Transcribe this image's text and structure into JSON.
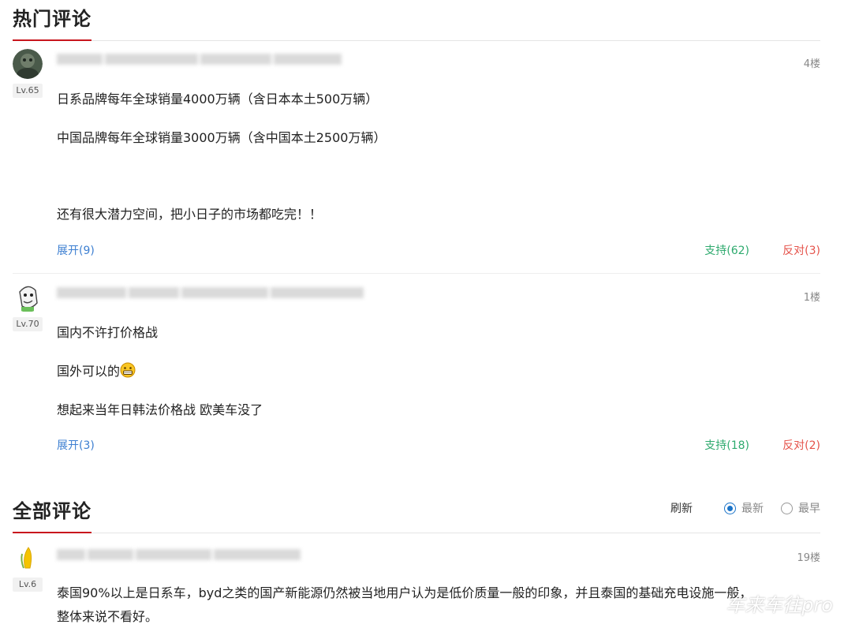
{
  "hot_section": {
    "title": "热门评论"
  },
  "hot_comments": [
    {
      "level": "Lv.65",
      "floor": "4楼",
      "lines": [
        "日系品牌每年全球销量4000万辆（含日本本土500万辆）",
        "中国品牌每年全球销量3000万辆（含中国本土2500万辆）",
        "还有很大潜力空间，把小日子的市场都吃完！！"
      ],
      "expand": "展开(9)",
      "support": "支持(62)",
      "oppose": "反对(3)"
    },
    {
      "level": "Lv.70",
      "floor": "1楼",
      "lines": [
        "国内不许打价格战",
        "国外可以的",
        " 想起来当年日韩法价格战  欧美车没了"
      ],
      "expand": "展开(3)",
      "support": "支持(18)",
      "oppose": "反对(2)"
    }
  ],
  "all_section": {
    "title": "全部评论",
    "refresh": "刷新",
    "sort_newest": "最新",
    "sort_oldest": "最早"
  },
  "all_comments": [
    {
      "level": "Lv.6",
      "floor": "19楼",
      "lines": [
        "泰国90%以上是日系车，byd之类的国产新能源仍然被当地用户认为是低价质量一般的印象，并且泰国的基础充电设施一般，",
        "整体来说不看好。"
      ]
    }
  ],
  "watermark": "车来车往pro",
  "colors": {
    "accent_red": "#c8161d",
    "link_blue": "#3d7fd1",
    "support_green": "#2eaa6e",
    "oppose_red": "#e5534b"
  }
}
